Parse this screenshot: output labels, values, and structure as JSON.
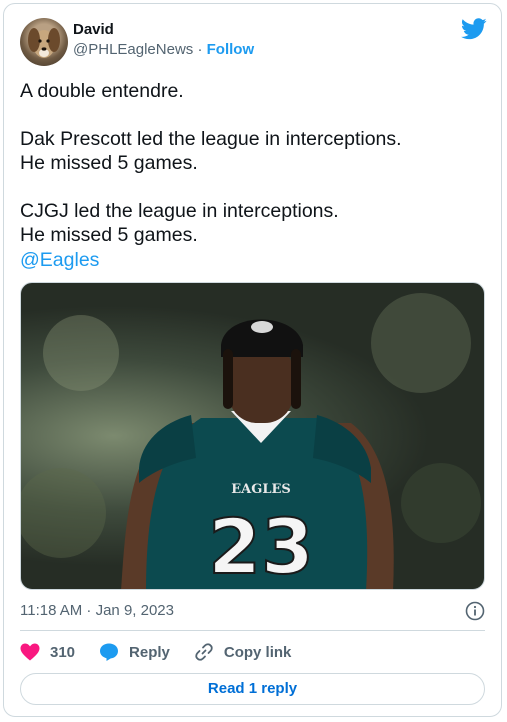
{
  "author": {
    "display_name": "David",
    "handle": "@PHLEagleNews",
    "separator": "·",
    "follow_label": "Follow"
  },
  "tweet": {
    "text": "A double entendre.\n\nDak Prescott led the league in interceptions.\nHe missed 5 games.\n\nCJGJ led the league in interceptions.\nHe missed 5 games.",
    "mention": "@Eagles",
    "timestamp": "11:18 AM · Jan 9, 2023"
  },
  "actions": {
    "like_count": "310",
    "reply_label": "Reply",
    "copy_link_label": "Copy link"
  },
  "read_replies_label": "Read 1 reply",
  "photo": {
    "jersey_text": "EAGLES",
    "jersey_number": "23"
  },
  "colors": {
    "accent": "#1d9bf0",
    "like": "#f91880",
    "muted": "#536471",
    "jersey": "#0c4a4f"
  }
}
